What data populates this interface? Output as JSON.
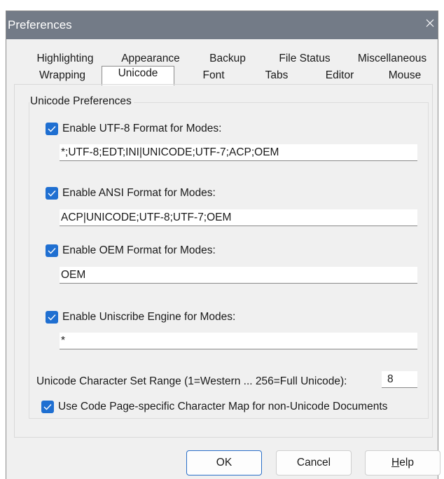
{
  "window": {
    "title": "Preferences"
  },
  "tabs": {
    "row1": [
      "Highlighting",
      "Appearance",
      "Backup",
      "File Status",
      "Miscellaneous"
    ],
    "row2": [
      "Wrapping",
      "Unicode",
      "Font",
      "Tabs",
      "Editor",
      "Mouse"
    ],
    "active": "Unicode"
  },
  "group": {
    "title": "Unicode Preferences"
  },
  "options": {
    "utf8": {
      "label": "Enable UTF-8 Format for Modes:",
      "checked": true,
      "value": "*;UTF-8;EDT;INI|UNICODE;UTF-7;ACP;OEM"
    },
    "ansi": {
      "label": "Enable ANSI Format for Modes:",
      "checked": true,
      "value": "ACP|UNICODE;UTF-8;UTF-7;OEM"
    },
    "oem": {
      "label": "Enable OEM Format for Modes:",
      "checked": true,
      "value": "OEM"
    },
    "uniscribe": {
      "label": "Enable Uniscribe Engine for Modes:",
      "checked": true,
      "value": "*"
    }
  },
  "range": {
    "label": "Unicode Character Set Range (1=Western ... 256=Full Unicode):",
    "value": "8"
  },
  "codepage": {
    "label": "Use Code Page-specific Character Map for non-Unicode Documents",
    "checked": true
  },
  "buttons": {
    "ok": "OK",
    "cancel": "Cancel",
    "help_rest": "elp",
    "help_mnemonic": "H"
  },
  "colors": {
    "titlebar": "#737b87",
    "checkbox": "#1f6fd1",
    "dialog_bg": "#f0f0f0"
  }
}
